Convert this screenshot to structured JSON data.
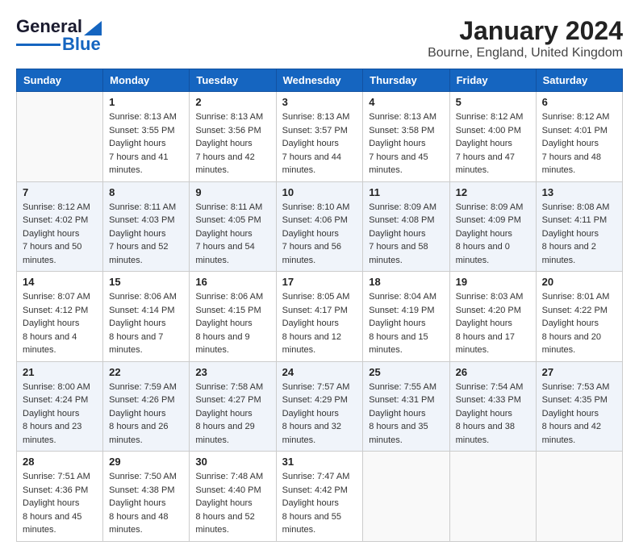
{
  "logo": {
    "line1": "General",
    "line2": "Blue"
  },
  "title": "January 2024",
  "subtitle": "Bourne, England, United Kingdom",
  "days_of_week": [
    "Sunday",
    "Monday",
    "Tuesday",
    "Wednesday",
    "Thursday",
    "Friday",
    "Saturday"
  ],
  "weeks": [
    [
      {
        "day": "",
        "info": ""
      },
      {
        "day": "1",
        "sunrise": "8:13 AM",
        "sunset": "3:55 PM",
        "daylight": "7 hours and 41 minutes."
      },
      {
        "day": "2",
        "sunrise": "8:13 AM",
        "sunset": "3:56 PM",
        "daylight": "7 hours and 42 minutes."
      },
      {
        "day": "3",
        "sunrise": "8:13 AM",
        "sunset": "3:57 PM",
        "daylight": "7 hours and 44 minutes."
      },
      {
        "day": "4",
        "sunrise": "8:13 AM",
        "sunset": "3:58 PM",
        "daylight": "7 hours and 45 minutes."
      },
      {
        "day": "5",
        "sunrise": "8:12 AM",
        "sunset": "4:00 PM",
        "daylight": "7 hours and 47 minutes."
      },
      {
        "day": "6",
        "sunrise": "8:12 AM",
        "sunset": "4:01 PM",
        "daylight": "7 hours and 48 minutes."
      }
    ],
    [
      {
        "day": "7",
        "sunrise": "8:12 AM",
        "sunset": "4:02 PM",
        "daylight": "7 hours and 50 minutes."
      },
      {
        "day": "8",
        "sunrise": "8:11 AM",
        "sunset": "4:03 PM",
        "daylight": "7 hours and 52 minutes."
      },
      {
        "day": "9",
        "sunrise": "8:11 AM",
        "sunset": "4:05 PM",
        "daylight": "7 hours and 54 minutes."
      },
      {
        "day": "10",
        "sunrise": "8:10 AM",
        "sunset": "4:06 PM",
        "daylight": "7 hours and 56 minutes."
      },
      {
        "day": "11",
        "sunrise": "8:09 AM",
        "sunset": "4:08 PM",
        "daylight": "7 hours and 58 minutes."
      },
      {
        "day": "12",
        "sunrise": "8:09 AM",
        "sunset": "4:09 PM",
        "daylight": "8 hours and 0 minutes."
      },
      {
        "day": "13",
        "sunrise": "8:08 AM",
        "sunset": "4:11 PM",
        "daylight": "8 hours and 2 minutes."
      }
    ],
    [
      {
        "day": "14",
        "sunrise": "8:07 AM",
        "sunset": "4:12 PM",
        "daylight": "8 hours and 4 minutes."
      },
      {
        "day": "15",
        "sunrise": "8:06 AM",
        "sunset": "4:14 PM",
        "daylight": "8 hours and 7 minutes."
      },
      {
        "day": "16",
        "sunrise": "8:06 AM",
        "sunset": "4:15 PM",
        "daylight": "8 hours and 9 minutes."
      },
      {
        "day": "17",
        "sunrise": "8:05 AM",
        "sunset": "4:17 PM",
        "daylight": "8 hours and 12 minutes."
      },
      {
        "day": "18",
        "sunrise": "8:04 AM",
        "sunset": "4:19 PM",
        "daylight": "8 hours and 15 minutes."
      },
      {
        "day": "19",
        "sunrise": "8:03 AM",
        "sunset": "4:20 PM",
        "daylight": "8 hours and 17 minutes."
      },
      {
        "day": "20",
        "sunrise": "8:01 AM",
        "sunset": "4:22 PM",
        "daylight": "8 hours and 20 minutes."
      }
    ],
    [
      {
        "day": "21",
        "sunrise": "8:00 AM",
        "sunset": "4:24 PM",
        "daylight": "8 hours and 23 minutes."
      },
      {
        "day": "22",
        "sunrise": "7:59 AM",
        "sunset": "4:26 PM",
        "daylight": "8 hours and 26 minutes."
      },
      {
        "day": "23",
        "sunrise": "7:58 AM",
        "sunset": "4:27 PM",
        "daylight": "8 hours and 29 minutes."
      },
      {
        "day": "24",
        "sunrise": "7:57 AM",
        "sunset": "4:29 PM",
        "daylight": "8 hours and 32 minutes."
      },
      {
        "day": "25",
        "sunrise": "7:55 AM",
        "sunset": "4:31 PM",
        "daylight": "8 hours and 35 minutes."
      },
      {
        "day": "26",
        "sunrise": "7:54 AM",
        "sunset": "4:33 PM",
        "daylight": "8 hours and 38 minutes."
      },
      {
        "day": "27",
        "sunrise": "7:53 AM",
        "sunset": "4:35 PM",
        "daylight": "8 hours and 42 minutes."
      }
    ],
    [
      {
        "day": "28",
        "sunrise": "7:51 AM",
        "sunset": "4:36 PM",
        "daylight": "8 hours and 45 minutes."
      },
      {
        "day": "29",
        "sunrise": "7:50 AM",
        "sunset": "4:38 PM",
        "daylight": "8 hours and 48 minutes."
      },
      {
        "day": "30",
        "sunrise": "7:48 AM",
        "sunset": "4:40 PM",
        "daylight": "8 hours and 52 minutes."
      },
      {
        "day": "31",
        "sunrise": "7:47 AM",
        "sunset": "4:42 PM",
        "daylight": "8 hours and 55 minutes."
      },
      {
        "day": "",
        "info": ""
      },
      {
        "day": "",
        "info": ""
      },
      {
        "day": "",
        "info": ""
      }
    ]
  ]
}
